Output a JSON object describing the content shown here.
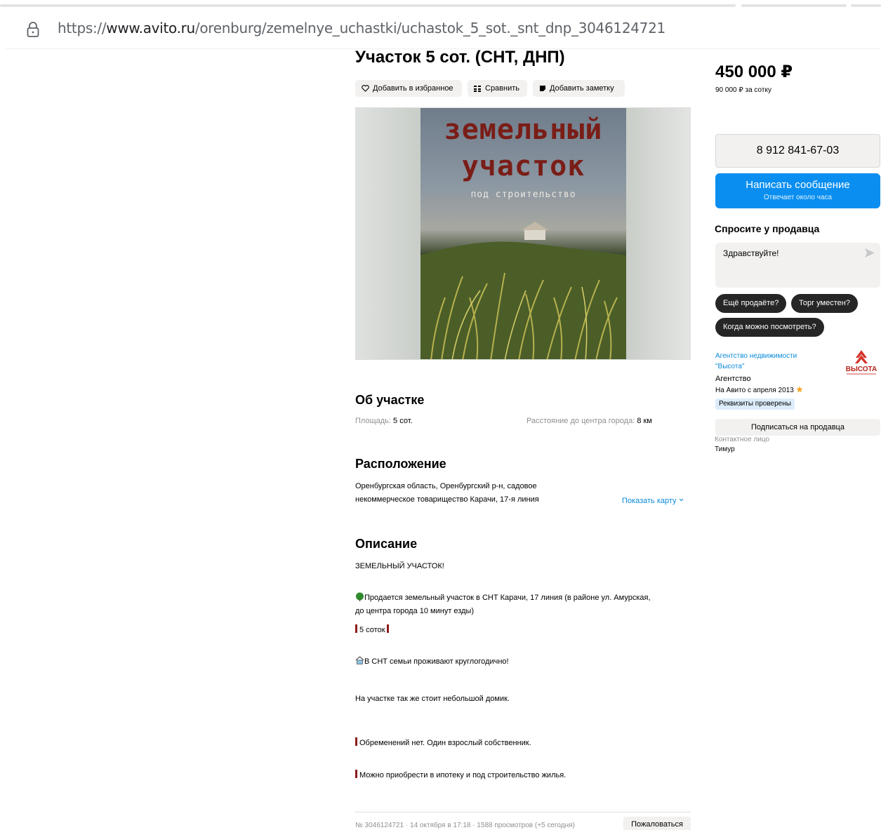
{
  "browser": {
    "url_prefix": "https://",
    "url_host": "www.avito.ru",
    "url_path": "/orenburg/zemelnye_uchastki/uchastok_5_sot._snt_dnp_3046124721"
  },
  "listing": {
    "title": "Участок 5 сот. (СНТ, ДНП)",
    "actions": {
      "favorite": "Добавить в избранное",
      "compare": "Сравнить",
      "note": "Добавить заметку"
    },
    "photo": {
      "line1": "земельный",
      "line2": "участок",
      "line3": "под строительство"
    },
    "about": {
      "heading": "Об участке",
      "area_label": "Площадь:",
      "area_value": "5 сот.",
      "distance_label": "Расстояние до центра города:",
      "distance_value": "8 км"
    },
    "location": {
      "heading": "Расположение",
      "line1": "Оренбургская область, Оренбургский р-н, садовое",
      "line2": "некоммерческое товарищество Карачи, 17-я линия",
      "map_link": "Показать карту"
    },
    "description": {
      "heading": "Описание",
      "p1": "ЗЕМЕЛЬНЫЙ УЧАСТОК!",
      "p2a": "Продается земельный участок в СНТ Карачи, 17 линия (в районе ул. Амурская,",
      "p2b": "до центра города 10 минут езды)",
      "p3": "5 соток",
      "p4": "В СНТ семьи проживают круглогодично!",
      "p5": "На участке так же стоит небольшой домик.",
      "p6": "Обременений нет. Один взрослый собственник.",
      "p7": "Можно приобрести в ипотеку и под строительство жилья."
    },
    "footer": {
      "meta": "№ 3046124721 · 14 октября в 17:18 · 1588 просмотров (+5 сегодня)",
      "complain": "Пожаловаться"
    }
  },
  "sidebar": {
    "price": "450 000 ₽",
    "price_per": "90 000 ₽ за сотку",
    "phone": "8 912 841-67-03",
    "message_button": "Написать сообщение",
    "message_sub": "Отвечает около часа",
    "ask_heading": "Спросите у продавца",
    "ask_placeholder": "Здравствуйте!",
    "chips": [
      "Ещё продаёте?",
      "Торг уместен?",
      "Когда можно посмотреть?"
    ],
    "seller_name_1": "Агентство недвижимости",
    "seller_name_2": "\"Высота\"",
    "seller_type": "Агентство",
    "seller_since": "На Авито с апреля 2013",
    "verified": "Реквизиты проверены",
    "subscribe": "Подписаться на продавца",
    "contact_label": "Контактное лицо",
    "contact_name": "Тимур",
    "logo_text": "ВЫСОТА"
  },
  "colors": {
    "accent_blue": "#0a8ff0",
    "link_blue": "#0a8ad9",
    "chip_dark": "#262626",
    "button_grey": "#f2f1f0"
  },
  "icons": [
    "lock-icon",
    "heart-icon",
    "compare-icon",
    "note-icon",
    "send-icon",
    "tree-icon",
    "house-icon",
    "star-icon",
    "chevron-down-icon"
  ]
}
